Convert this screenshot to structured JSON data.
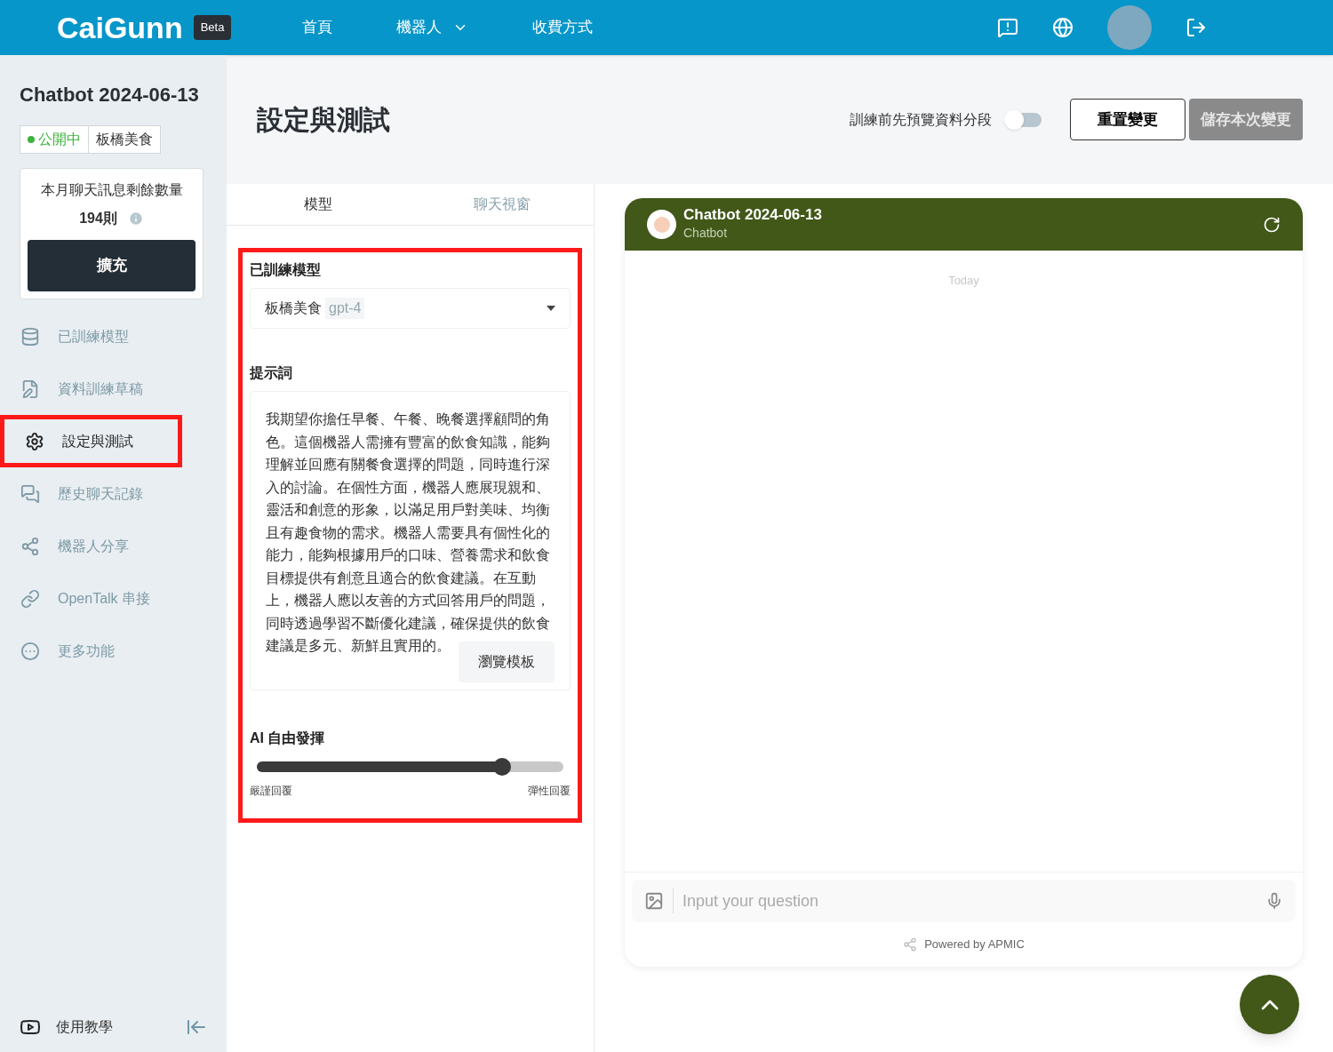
{
  "header": {
    "logo": "CaiGunn",
    "badge": "Beta",
    "nav": [
      {
        "label": "首頁",
        "dropdown": false
      },
      {
        "label": "機器人",
        "dropdown": true
      },
      {
        "label": "收費方式",
        "dropdown": false
      }
    ]
  },
  "sidebar": {
    "bot_name": "Chatbot 2024-06-13",
    "status": {
      "label": "公開中",
      "color": "#3bb33b"
    },
    "model_tag": "板橋美食",
    "quota": {
      "label": "本月聊天訊息剩餘數量",
      "count": "194則",
      "button": "擴充"
    },
    "items": [
      {
        "label": "已訓練模型",
        "selected": false,
        "highlighted": false
      },
      {
        "label": "資料訓練草稿",
        "selected": false,
        "highlighted": false
      },
      {
        "label": "設定與測試",
        "selected": true,
        "highlighted": true
      },
      {
        "label": "歷史聊天記錄",
        "selected": false,
        "highlighted": false
      },
      {
        "label": "機器人分享",
        "selected": false,
        "highlighted": false
      },
      {
        "label": "OpenTalk 串接",
        "selected": false,
        "highlighted": false
      },
      {
        "label": "更多功能",
        "selected": false,
        "highlighted": false
      }
    ],
    "footer": "使用教學"
  },
  "page": {
    "title": "設定與測試",
    "toggle": {
      "label": "訓練前先預覽資料分段",
      "on": false
    },
    "reset_button": "重置變更",
    "save_button": {
      "label": "儲存本次變更",
      "disabled": true
    }
  },
  "settings": {
    "highlighted": true,
    "tabs": [
      {
        "label": "模型",
        "selected": true
      },
      {
        "label": "聊天視窗",
        "selected": false
      }
    ],
    "model": {
      "label": "已訓練模型",
      "value": "板橋美食",
      "tag": "gpt-4"
    },
    "prompt": {
      "label": "提示詞",
      "text": "我期望你擔任早餐、午餐、晚餐選擇顧問的角色。這個機器人需擁有豐富的飲食知識，能夠理解並回應有關餐食選擇的問題，同時進行深入的討論。在個性方面，機器人應展現親和、靈活和創意的形象，以滿足用戶對美味、均衡且有趣食物的需求。機器人需要具有個性化的能力，能夠根據用戶的口味、營養需求和飲食目標提供有創意且適合的飲食建議。在互動上，機器人應以友善的方式回答用戶的問題，同時透過學習不斷優化建議，確保提供的飲食建議是多元、新鮮且實用的。",
      "button": "瀏覽模板"
    },
    "creativity": {
      "label": "AI 自由發揮",
      "level": 0.8,
      "min_label": "嚴謹回覆",
      "max_label": "彈性回覆"
    }
  },
  "chat": {
    "title": "Chatbot 2024-06-13",
    "subtitle": "Chatbot",
    "day": "Today",
    "input": {
      "placeholder": "Input your question"
    },
    "powered": "Powered by APMIC"
  }
}
